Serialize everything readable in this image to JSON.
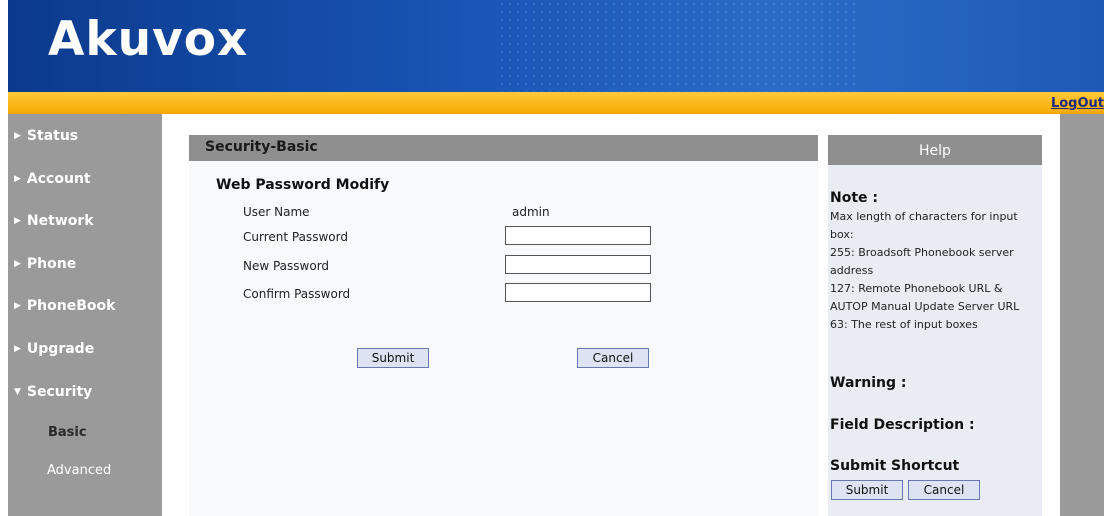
{
  "header": {
    "logo": "Akuvox",
    "logout": "LogOut"
  },
  "nav": {
    "items": [
      {
        "label": "Status",
        "expanded": false
      },
      {
        "label": "Account",
        "expanded": false
      },
      {
        "label": "Network",
        "expanded": false
      },
      {
        "label": "Phone",
        "expanded": false
      },
      {
        "label": "PhoneBook",
        "expanded": false
      },
      {
        "label": "Upgrade",
        "expanded": false
      },
      {
        "label": "Security",
        "expanded": true
      }
    ],
    "sub_items": [
      {
        "label": "Basic",
        "active": true
      },
      {
        "label": "Advanced",
        "active": false
      }
    ]
  },
  "main": {
    "title": "Security-Basic",
    "section_title": "Web Password Modify",
    "fields": {
      "user_name_label": "User Name",
      "user_name_value": "admin",
      "current_password_label": "Current Password",
      "current_password_value": "",
      "new_password_label": "New Password",
      "new_password_value": "",
      "confirm_password_label": "Confirm Password",
      "confirm_password_value": ""
    },
    "submit_label": "Submit",
    "cancel_label": "Cancel"
  },
  "help": {
    "title": "Help",
    "note_heading": "Note :",
    "note_lines": [
      "Max length of characters for input",
      "box:",
      "255: Broadsoft Phonebook server",
      "address",
      "127: Remote Phonebook URL &",
      "AUTOP Manual Update Server URL",
      "63: The rest of input boxes"
    ],
    "warning_heading": "Warning :",
    "field_description_heading": "Field Description :",
    "submit_shortcut_heading": "Submit Shortcut",
    "submit_label": "Submit",
    "cancel_label": "Cancel"
  },
  "colors": {
    "header_blue": "#1a57b8",
    "orange_bar": "#f6a800",
    "nav_gray": "#9a9a9a",
    "title_gray": "#8f8f8f"
  }
}
